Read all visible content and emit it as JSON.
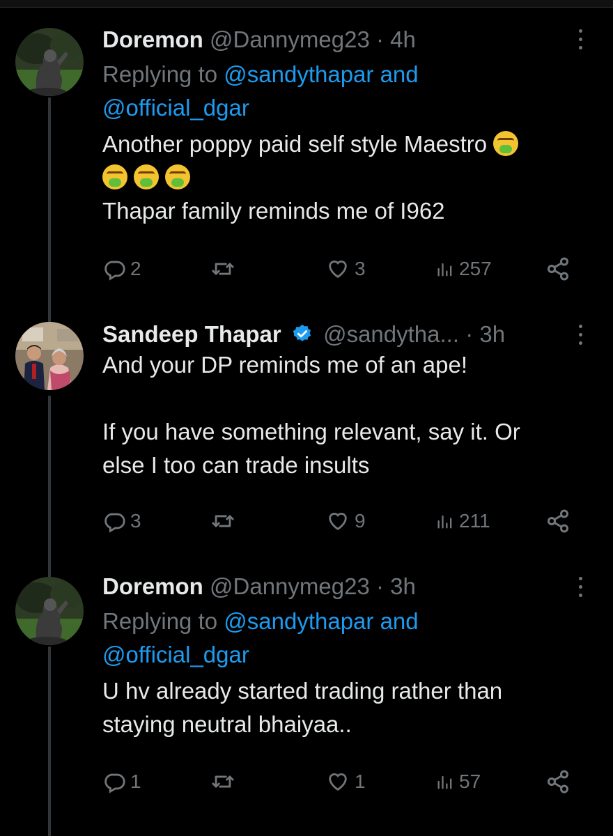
{
  "thread": [
    {
      "name": "Doremon",
      "handle": "@Dannymeg23",
      "time": "4h",
      "replying_prefix": "Replying to ",
      "replying_to_1": "@sandythapar and",
      "replying_to_2": "@official_dgar",
      "text_line1": "Another poppy paid self style Maestro",
      "text_line2": "Thapar family reminds me of I962",
      "emoji_count": 4,
      "emoji_name": "vomiting-face-emoji",
      "replies": "2",
      "retweets": "",
      "likes": "3",
      "views": "257"
    },
    {
      "name": "Sandeep Thapar",
      "handle": "@sandytha...",
      "time": "3h",
      "verified": true,
      "text_line1": "And your DP reminds me of an ape!",
      "text_line2": "If you have something relevant, say it. Or",
      "text_line3": "else I too can trade insults",
      "replies": "3",
      "retweets": "",
      "likes": "9",
      "views": "211"
    },
    {
      "name": "Doremon",
      "handle": "@Dannymeg23",
      "time": "3h",
      "replying_prefix": "Replying to ",
      "replying_to_1": "@sandythapar and",
      "replying_to_2": "@official_dgar",
      "text_line1": "U hv already started trading rather than",
      "text_line2": "staying neutral bhaiyaa..",
      "replies": "1",
      "retweets": "",
      "likes": "1",
      "views": "57"
    }
  ],
  "separator": " · ",
  "colors": {
    "background": "#000000",
    "text": "#e7e9ea",
    "secondary": "#71767b",
    "accent": "#1d9bf0",
    "thread_line": "#333639"
  },
  "icons": [
    "reply-icon",
    "retweet-icon",
    "like-icon",
    "views-icon",
    "share-icon",
    "more-icon",
    "verified-badge-icon"
  ]
}
